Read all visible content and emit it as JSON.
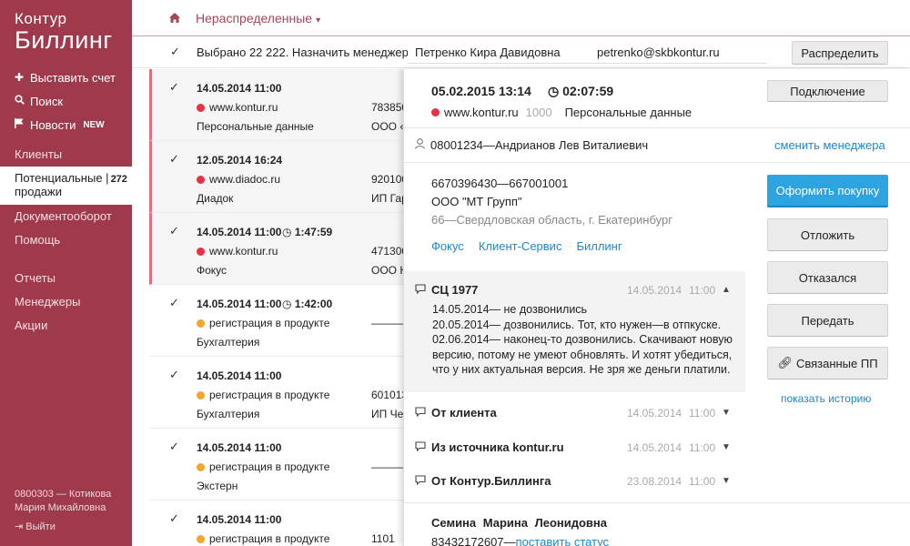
{
  "sidebar": {
    "logo_top": "Контур",
    "logo_bottom": "Биллинг",
    "actions": [
      {
        "icon": "plus-icon",
        "label": "Выставить счет"
      },
      {
        "icon": "search-icon",
        "label": "Поиск"
      },
      {
        "icon": "flag-icon",
        "label": "Новости",
        "badge": "NEW"
      }
    ],
    "nav": [
      {
        "label": "Клиенты"
      },
      {
        "label": "Потенциальные",
        "label2": "продажи",
        "count": "272",
        "active": true
      },
      {
        "label": "Документооборот"
      },
      {
        "label": "Помощь"
      }
    ],
    "nav2": [
      {
        "label": "Отчеты"
      },
      {
        "label": "Менеджеры"
      },
      {
        "label": "Акции"
      }
    ],
    "user_line1": "0800303 — Котикова",
    "user_line2": "Мария Михайловна",
    "logout": "Выйти"
  },
  "topbar": {
    "breadcrumb": "Нераспределенные"
  },
  "selection": {
    "text": "Выбрано 22 222. Назначить менеджеру:",
    "manager_value": "Петренко Кира Давидовна",
    "manager_email": "petrenko@skbkontur.ru",
    "distribute_label": "Распределить"
  },
  "list": [
    {
      "date": "14.05.2014 11:00",
      "duration": "",
      "source": "www.kontur.ru",
      "dot": "red",
      "product": "Персональные данные",
      "inn": "783850",
      "org": "ООО «",
      "highlighted": true
    },
    {
      "date": "12.05.2014 16:24",
      "duration": "",
      "source": "www.diadoc.ru",
      "dot": "red",
      "product": "Диадок",
      "inn": "920100",
      "org": "ИП Гар",
      "highlighted": true
    },
    {
      "date": "14.05.2014 11:00",
      "duration": "1:47:59",
      "source": "www.kontur.ru",
      "dot": "red",
      "product": "Фокус",
      "inn": "471300",
      "org": "ООО Н",
      "highlighted": true
    },
    {
      "date": "14.05.2014 11:00",
      "duration": "1:42:00",
      "source": "регистрация в продукте",
      "dot": "orange",
      "product": "Бухгалтерия",
      "inn": "———",
      "org": "",
      "highlighted": false
    },
    {
      "date": "14.05.2014 11:00",
      "duration": "",
      "source": "регистрация в продукте",
      "dot": "orange",
      "product": "Бухгалтерия",
      "inn": "601013",
      "org": "ИП Чер",
      "highlighted": false
    },
    {
      "date": "14.05.2014 11:00",
      "duration": "",
      "source": "регистрация в продукте",
      "dot": "orange",
      "product": "Экстерн",
      "inn": "———",
      "org": "",
      "highlighted": false
    },
    {
      "date": "14.05.2014 11:00",
      "duration": "",
      "source": "регистрация в продукте",
      "dot": "orange",
      "product": "",
      "inn": "1101",
      "org": "",
      "highlighted": false
    }
  ],
  "detail": {
    "date": "05.02.2015  13:14",
    "duration": "02:07:59",
    "source": "www.kontur.ru",
    "source_num": "1000",
    "product": "Персональные данные",
    "connect_label": "Подключение",
    "manager": "08001234—Андрианов Лев Виталиевич",
    "change_manager": "сменить менеджера",
    "inn": "6670396430—667001001",
    "org": "ООО \"МТ Групп\"",
    "region": "66—Свердловская область, г. Екатеринбург",
    "links": [
      "Фокус",
      "Клиент-Сервис",
      "Биллинг"
    ],
    "buttons": {
      "buy": "Оформить покупку",
      "postpone": "Отложить",
      "refused": "Отказался",
      "transfer": "Передать",
      "related": "Связанные ПП"
    },
    "show_history": "показать историю",
    "comments": [
      {
        "title": "СЦ 1977",
        "date": "14.05.2014",
        "time": "11:00",
        "open": true,
        "lines": [
          "14.05.2014— не дозвонились",
          "20.05.2014— дозвонились. Тот, кто нужен—в отпкуске.",
          "02.06.2014— наконец-то дозвонились. Скачивают новую версию, потому не умеют обновлять. И хотят убедиться, что у них актуальная версия. Не зря же деньги платили."
        ]
      },
      {
        "title": "От клиента",
        "date": "14.05.2014",
        "time": "11:00",
        "open": false
      },
      {
        "title": "Из источника  kontur.ru",
        "date": "14.05.2014",
        "time": "11:00",
        "open": false
      },
      {
        "title": "От Контур.Биллинга",
        "date": "23.08.2014",
        "time": "11:00",
        "open": false
      }
    ],
    "contact_name": "Семина Марина Леонидовна",
    "contact_phone": "83432172607—",
    "set_status": "поставить статус"
  },
  "colors": {
    "sidebar": "#9e3a4b",
    "accent": "#a54555",
    "link": "#1d88c9",
    "primary_button": "#2da3e0",
    "dot_red": "#e53244",
    "dot_orange": "#f3a52c"
  }
}
